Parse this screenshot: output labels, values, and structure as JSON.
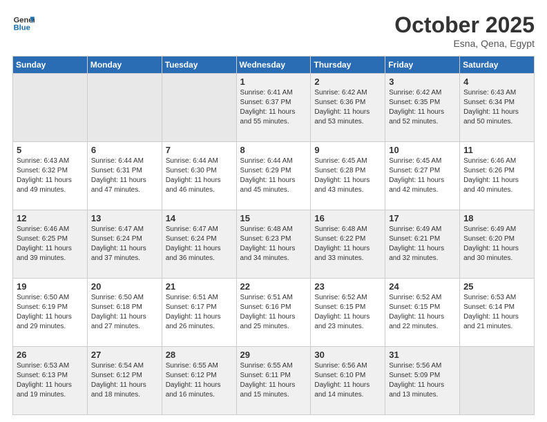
{
  "header": {
    "logo_line1": "General",
    "logo_line2": "Blue",
    "month": "October 2025",
    "location": "Esna, Qena, Egypt"
  },
  "weekdays": [
    "Sunday",
    "Monday",
    "Tuesday",
    "Wednesday",
    "Thursday",
    "Friday",
    "Saturday"
  ],
  "rows": [
    [
      {
        "num": "",
        "text": ""
      },
      {
        "num": "",
        "text": ""
      },
      {
        "num": "",
        "text": ""
      },
      {
        "num": "1",
        "text": "Sunrise: 6:41 AM\nSunset: 6:37 PM\nDaylight: 11 hours\nand 55 minutes."
      },
      {
        "num": "2",
        "text": "Sunrise: 6:42 AM\nSunset: 6:36 PM\nDaylight: 11 hours\nand 53 minutes."
      },
      {
        "num": "3",
        "text": "Sunrise: 6:42 AM\nSunset: 6:35 PM\nDaylight: 11 hours\nand 52 minutes."
      },
      {
        "num": "4",
        "text": "Sunrise: 6:43 AM\nSunset: 6:34 PM\nDaylight: 11 hours\nand 50 minutes."
      }
    ],
    [
      {
        "num": "5",
        "text": "Sunrise: 6:43 AM\nSunset: 6:32 PM\nDaylight: 11 hours\nand 49 minutes."
      },
      {
        "num": "6",
        "text": "Sunrise: 6:44 AM\nSunset: 6:31 PM\nDaylight: 11 hours\nand 47 minutes."
      },
      {
        "num": "7",
        "text": "Sunrise: 6:44 AM\nSunset: 6:30 PM\nDaylight: 11 hours\nand 46 minutes."
      },
      {
        "num": "8",
        "text": "Sunrise: 6:44 AM\nSunset: 6:29 PM\nDaylight: 11 hours\nand 45 minutes."
      },
      {
        "num": "9",
        "text": "Sunrise: 6:45 AM\nSunset: 6:28 PM\nDaylight: 11 hours\nand 43 minutes."
      },
      {
        "num": "10",
        "text": "Sunrise: 6:45 AM\nSunset: 6:27 PM\nDaylight: 11 hours\nand 42 minutes."
      },
      {
        "num": "11",
        "text": "Sunrise: 6:46 AM\nSunset: 6:26 PM\nDaylight: 11 hours\nand 40 minutes."
      }
    ],
    [
      {
        "num": "12",
        "text": "Sunrise: 6:46 AM\nSunset: 6:25 PM\nDaylight: 11 hours\nand 39 minutes."
      },
      {
        "num": "13",
        "text": "Sunrise: 6:47 AM\nSunset: 6:24 PM\nDaylight: 11 hours\nand 37 minutes."
      },
      {
        "num": "14",
        "text": "Sunrise: 6:47 AM\nSunset: 6:24 PM\nDaylight: 11 hours\nand 36 minutes."
      },
      {
        "num": "15",
        "text": "Sunrise: 6:48 AM\nSunset: 6:23 PM\nDaylight: 11 hours\nand 34 minutes."
      },
      {
        "num": "16",
        "text": "Sunrise: 6:48 AM\nSunset: 6:22 PM\nDaylight: 11 hours\nand 33 minutes."
      },
      {
        "num": "17",
        "text": "Sunrise: 6:49 AM\nSunset: 6:21 PM\nDaylight: 11 hours\nand 32 minutes."
      },
      {
        "num": "18",
        "text": "Sunrise: 6:49 AM\nSunset: 6:20 PM\nDaylight: 11 hours\nand 30 minutes."
      }
    ],
    [
      {
        "num": "19",
        "text": "Sunrise: 6:50 AM\nSunset: 6:19 PM\nDaylight: 11 hours\nand 29 minutes."
      },
      {
        "num": "20",
        "text": "Sunrise: 6:50 AM\nSunset: 6:18 PM\nDaylight: 11 hours\nand 27 minutes."
      },
      {
        "num": "21",
        "text": "Sunrise: 6:51 AM\nSunset: 6:17 PM\nDaylight: 11 hours\nand 26 minutes."
      },
      {
        "num": "22",
        "text": "Sunrise: 6:51 AM\nSunset: 6:16 PM\nDaylight: 11 hours\nand 25 minutes."
      },
      {
        "num": "23",
        "text": "Sunrise: 6:52 AM\nSunset: 6:15 PM\nDaylight: 11 hours\nand 23 minutes."
      },
      {
        "num": "24",
        "text": "Sunrise: 6:52 AM\nSunset: 6:15 PM\nDaylight: 11 hours\nand 22 minutes."
      },
      {
        "num": "25",
        "text": "Sunrise: 6:53 AM\nSunset: 6:14 PM\nDaylight: 11 hours\nand 21 minutes."
      }
    ],
    [
      {
        "num": "26",
        "text": "Sunrise: 6:53 AM\nSunset: 6:13 PM\nDaylight: 11 hours\nand 19 minutes."
      },
      {
        "num": "27",
        "text": "Sunrise: 6:54 AM\nSunset: 6:12 PM\nDaylight: 11 hours\nand 18 minutes."
      },
      {
        "num": "28",
        "text": "Sunrise: 6:55 AM\nSunset: 6:12 PM\nDaylight: 11 hours\nand 16 minutes."
      },
      {
        "num": "29",
        "text": "Sunrise: 6:55 AM\nSunset: 6:11 PM\nDaylight: 11 hours\nand 15 minutes."
      },
      {
        "num": "30",
        "text": "Sunrise: 6:56 AM\nSunset: 6:10 PM\nDaylight: 11 hours\nand 14 minutes."
      },
      {
        "num": "31",
        "text": "Sunrise: 5:56 AM\nSunset: 5:09 PM\nDaylight: 11 hours\nand 13 minutes."
      },
      {
        "num": "",
        "text": ""
      }
    ]
  ]
}
